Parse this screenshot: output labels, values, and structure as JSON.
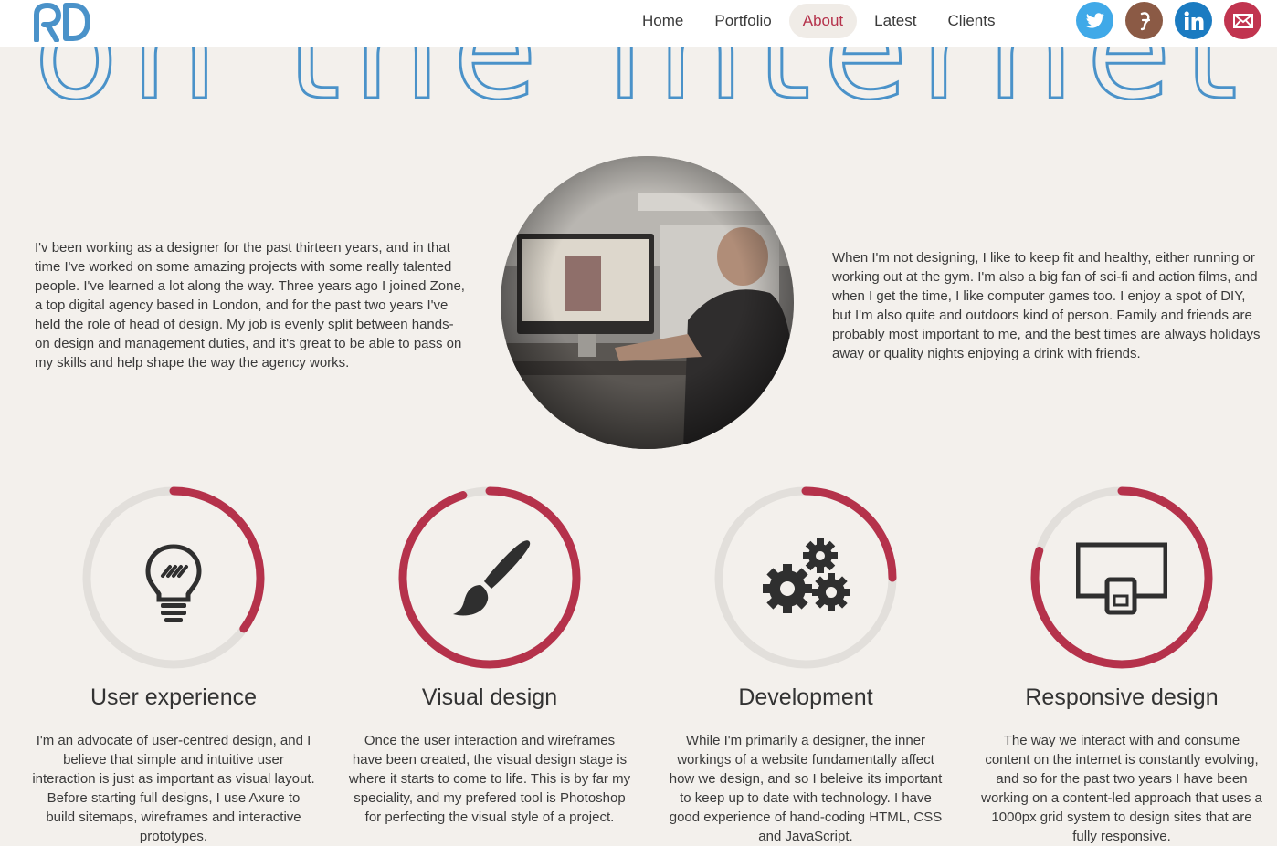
{
  "nav": {
    "items": [
      {
        "label": "Home"
      },
      {
        "label": "Portfolio"
      },
      {
        "label": "About"
      },
      {
        "label": "Latest"
      },
      {
        "label": "Clients"
      }
    ],
    "active": "About"
  },
  "social": [
    {
      "name": "twitter-icon",
      "color": "#40a9e8"
    },
    {
      "name": "forrst-icon",
      "color": "#8b5a45"
    },
    {
      "name": "linkedin-icon",
      "color": "#1b7bc1"
    },
    {
      "name": "email-icon",
      "color": "#c1344f"
    }
  ],
  "hero": {
    "text": "on the internet"
  },
  "intro": {
    "left": "I'v been working as a designer for the past thirteen years, and in that time I've worked on some amazing projects with some really talented people. I've learned a lot along the way. Three years ago I joined Zone, a top digital agency based in London, and for the past two years I've held the role of head of design. My job is evenly split between hands-on design and management duties, and it's great to be able to pass on my skills and help shape the way the agency works.",
    "right": "When I'm not designing, I like to keep fit and healthy, either running or working out at the gym. I'm also a big fan of sci-fi and action films, and when I get the time, I like computer games too. I enjoy a spot of DIY, but I'm also quite and outdoors kind of person. Family and friends are probably most important to me, and the best times are always holidays away or quality nights enjoying a drink with friends."
  },
  "colors": {
    "accent": "#b5324b",
    "ring_track": "#e2dfdb",
    "brand_blue": "#4a92c9"
  },
  "skills": [
    {
      "title": "User experience",
      "icon": "lightbulb-icon",
      "progress": 0.35,
      "text": "I'm an advocate of user-centred design, and I believe that simple and intuitive user interaction is just as important as visual layout. Before starting full designs, I use Axure to build sitemaps, wireframes and interactive prototypes."
    },
    {
      "title": "Visual design",
      "icon": "paintbrush-icon",
      "progress": 0.95,
      "text": "Once the user interaction and wireframes have been created, the visual design stage is where it starts to come to life. This is by far my speciality, and my prefered tool is Photoshop for perfecting the visual style of a project."
    },
    {
      "title": "Development",
      "icon": "gears-icon",
      "progress": 0.25,
      "text": "While I'm primarily a designer, the inner workings of a website fundamentally affect how we design, and so I beleive its important to keep up to date with technology. I have good experience of hand-coding HTML, CSS and JavaScript."
    },
    {
      "title": "Responsive design",
      "icon": "responsive-devices-icon",
      "progress": 0.8,
      "text": "The way we interact with and consume content on the internet is constantly evolving, and so for the past two years I have been working on a content-led approach that uses a 1000px grid system to design sites that are fully responsive."
    }
  ]
}
